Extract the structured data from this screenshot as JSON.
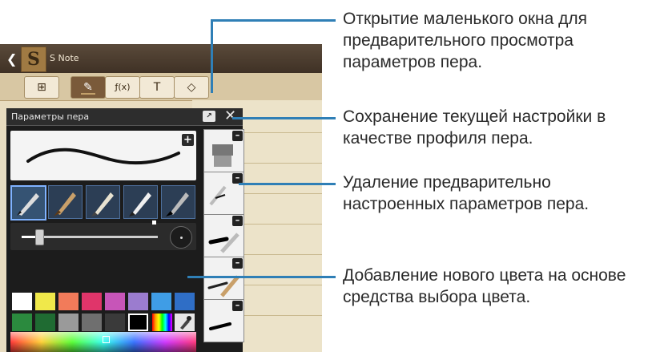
{
  "app": {
    "title": "S Note",
    "back_icon": "chevron-left-icon",
    "logo_letter": "S"
  },
  "toolbar": {
    "buttons": [
      {
        "icon": "add-page-icon",
        "glyph": "⊞"
      },
      {
        "icon": "pen-icon",
        "glyph": "✎",
        "active": true
      },
      {
        "icon": "formula-icon",
        "glyph": "ƒ(x)"
      },
      {
        "icon": "text-icon",
        "glyph": "T"
      },
      {
        "icon": "eraser-icon",
        "glyph": "◇"
      }
    ]
  },
  "pen_panel": {
    "title": "Параметры пера",
    "preview_icon": "preview-window-icon",
    "close_icon": "close-icon",
    "add_profile_icon": "plus-icon",
    "pen_types": [
      "fountain-pen-icon",
      "brush-icon",
      "pencil-icon",
      "marker-icon",
      "calligraphy-pen-icon"
    ],
    "selected_pen_index": 0,
    "size_level": 0.12,
    "colors_row1": [
      "#ffffff",
      "#f0e84a",
      "#f27b5a",
      "#e0356a",
      "#c755b8",
      "#9b7ccf",
      "#3f9de6",
      "#2f6ec6"
    ],
    "colors_row2": [
      "#2b8a3e",
      "#1f6b32",
      "#9a9a9a",
      "#6f6f6f",
      "#3a3a3a",
      "#000000"
    ],
    "selected_color": "#000000",
    "rainbow_icon": "rainbow-palette-icon",
    "eyedropper_icon": "eyedropper-icon",
    "profiles": [
      {
        "icon": "highlighter-profile-icon"
      },
      {
        "icon": "pen-profile-icon"
      },
      {
        "icon": "marker-profile-icon"
      },
      {
        "icon": "brush-profile-icon"
      },
      {
        "icon": "calligraphy-profile-icon"
      }
    ],
    "remove_icon": "minus-icon"
  },
  "callouts": [
    "Открытие маленького окна для предварительного просмотра параметров пера.",
    "Сохранение текущей настройки в качестве профиля пера.",
    "Удаление предварительно настроенных параметров пера.",
    "Добавление нового цвета на основе средства выбора цвета."
  ],
  "accent_color": "#2f7fb6"
}
